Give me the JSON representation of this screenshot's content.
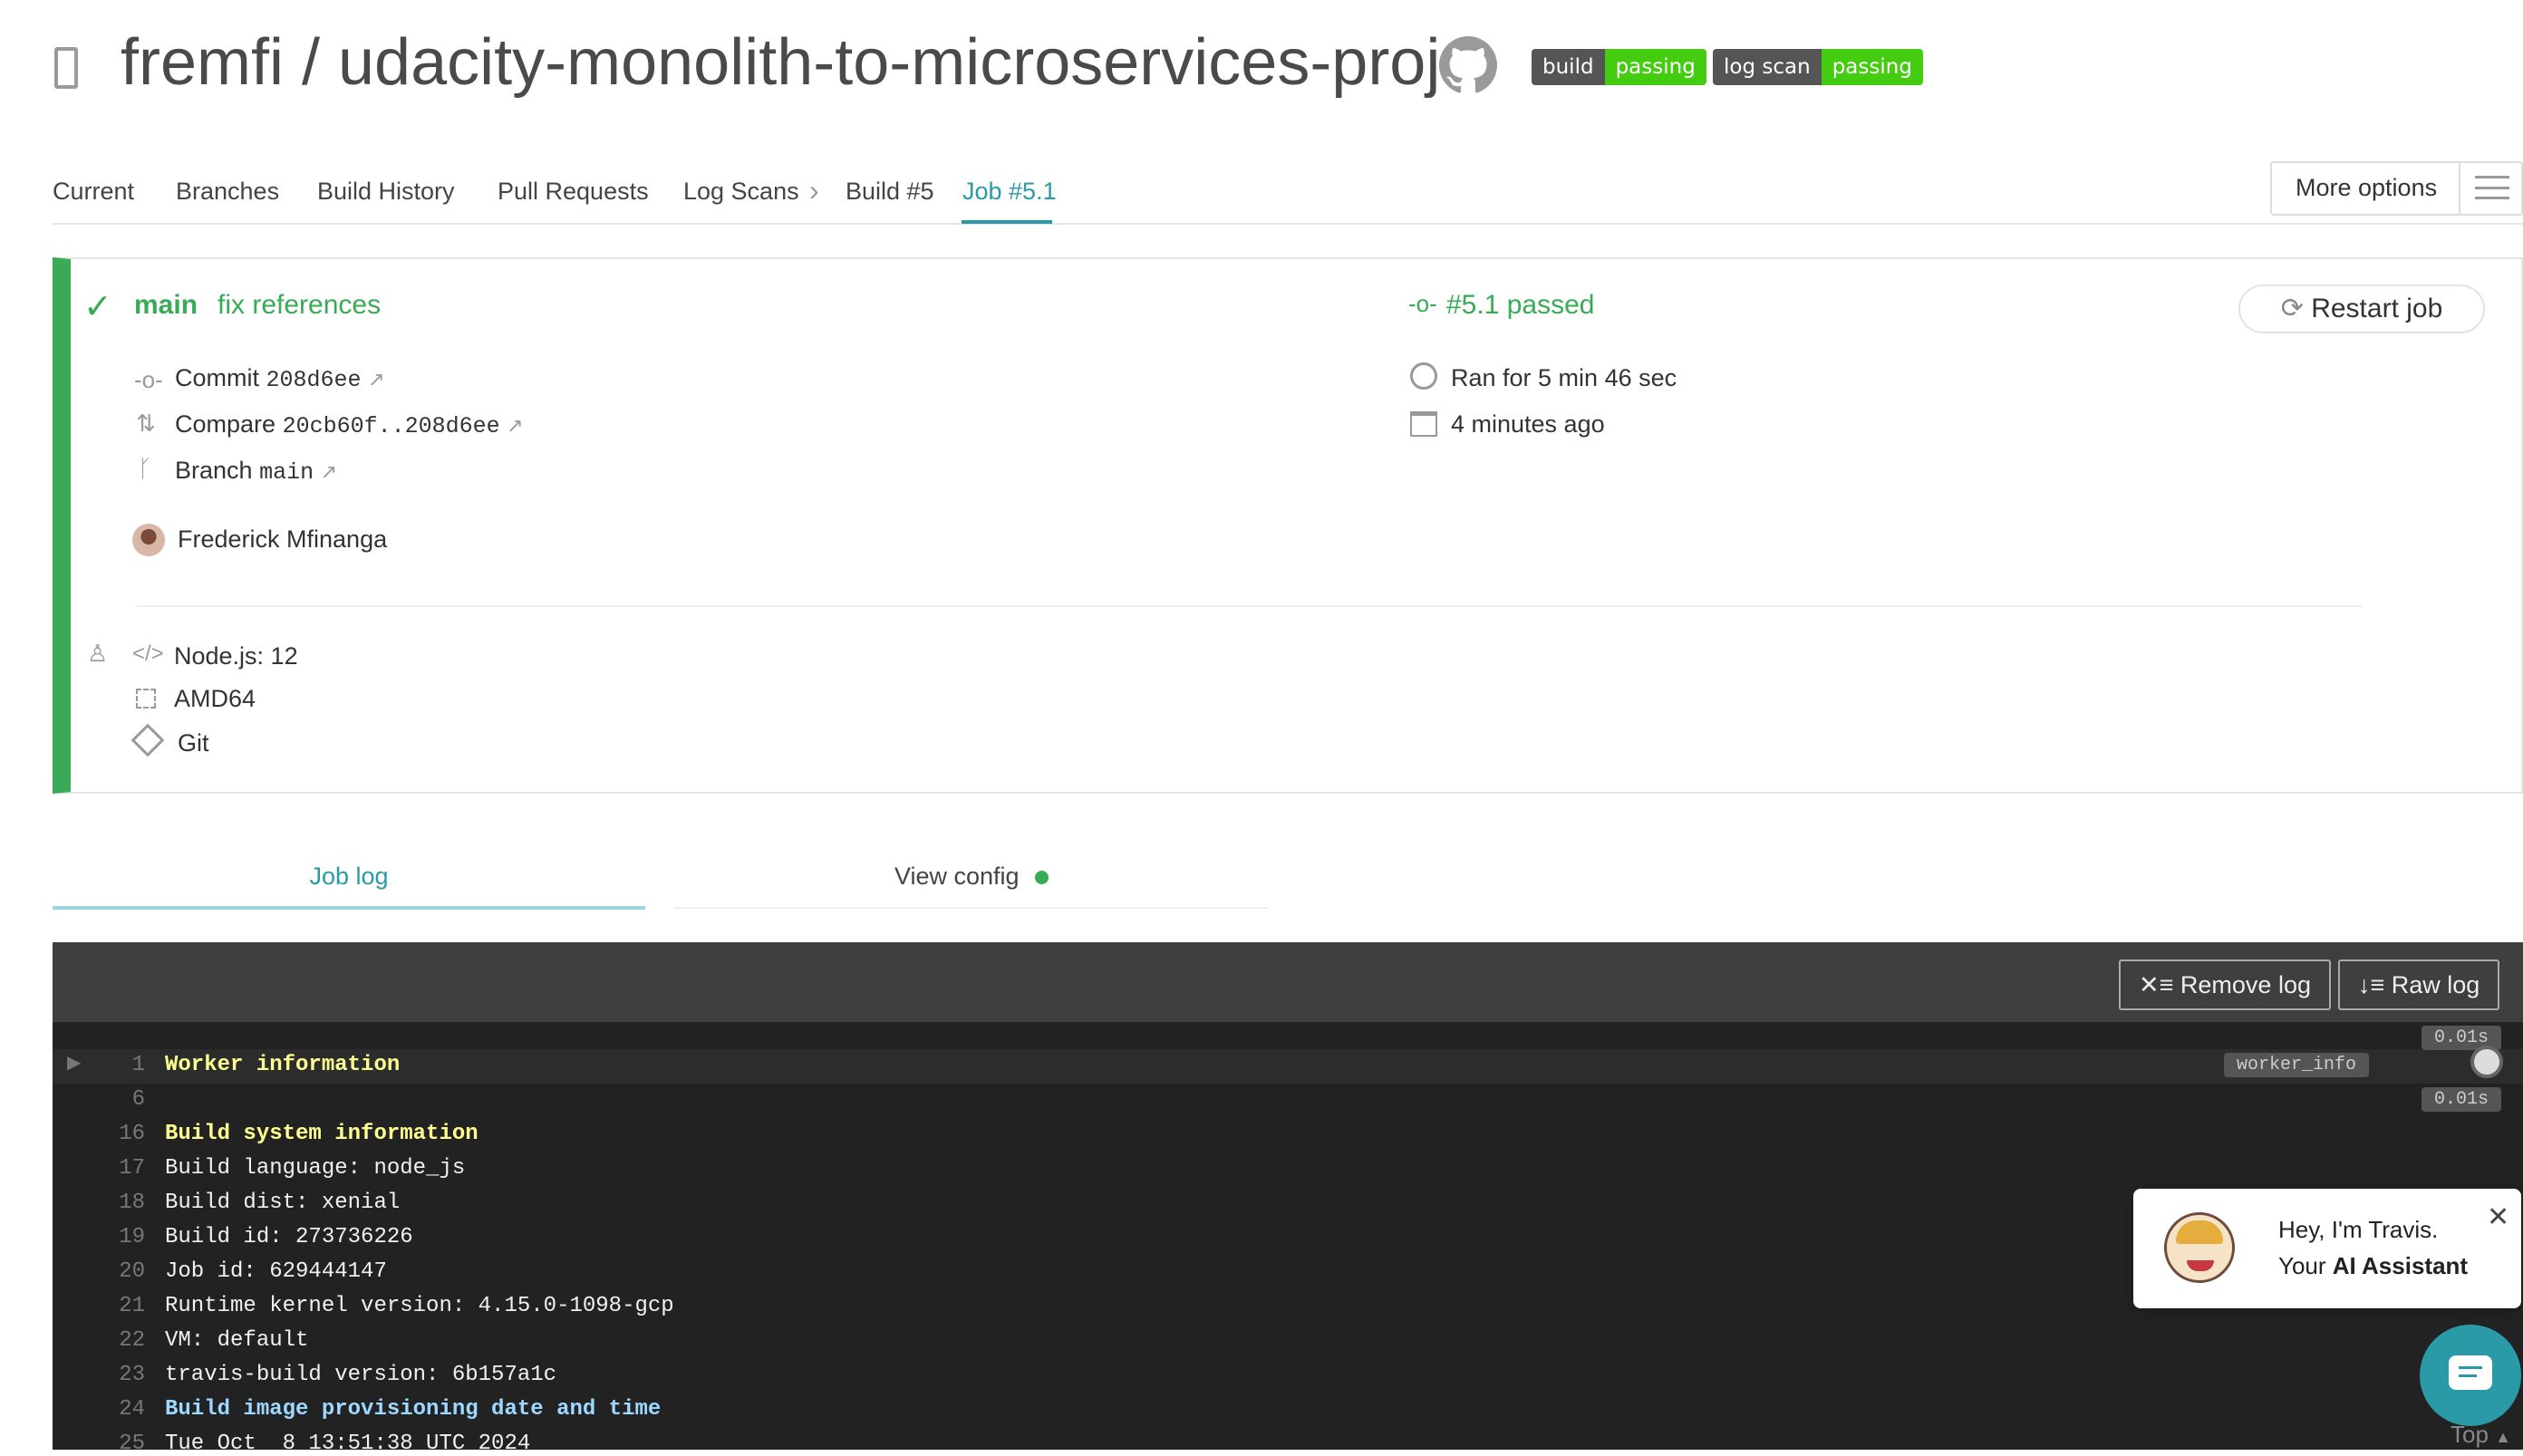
{
  "header": {
    "title": "fremfi / udacity-monolith-to-microservices-proj",
    "badges": [
      {
        "left": "build",
        "right": "passing"
      },
      {
        "left": "log scan",
        "right": "passing"
      }
    ]
  },
  "nav": {
    "items": [
      "Current",
      "Branches",
      "Build History",
      "Pull Requests",
      "Log Scans"
    ],
    "build": "Build #5",
    "job": "Job #5.1",
    "more_options": "More options"
  },
  "job": {
    "branch": "main",
    "message": "fix references",
    "status": "#5.1 passed",
    "restart": "Restart job",
    "commit_label": "Commit",
    "commit": "208d6ee",
    "compare_label": "Compare",
    "compare": "20cb60f..208d6ee",
    "branch_label": "Branch",
    "branch_value": "main",
    "ran_for": "Ran for 5 min 46 sec",
    "time_ago": "4 minutes ago",
    "author": "Frederick Mfinanga",
    "language": "Node.js: 12",
    "arch": "AMD64",
    "vcs": "Git"
  },
  "tabs": {
    "job_log": "Job log",
    "view_config": "View config"
  },
  "log": {
    "remove_log": "Remove log",
    "raw_log": "Raw log",
    "lines": [
      {
        "n": "1",
        "t": "Worker information",
        "style": "y"
      },
      {
        "n": "6",
        "t": "",
        "style": ""
      },
      {
        "n": "16",
        "t": "Build system information",
        "style": "y"
      },
      {
        "n": "17",
        "t": "Build language: node_js",
        "style": ""
      },
      {
        "n": "18",
        "t": "Build dist: xenial",
        "style": ""
      },
      {
        "n": "19",
        "t": "Build id: 273736226",
        "style": ""
      },
      {
        "n": "20",
        "t": "Job id: 629444147",
        "style": ""
      },
      {
        "n": "21",
        "t": "Runtime kernel version: 4.15.0-1098-gcp",
        "style": ""
      },
      {
        "n": "22",
        "t": "VM: default",
        "style": ""
      },
      {
        "n": "23",
        "t": "travis-build version: 6b157a1c",
        "style": ""
      },
      {
        "n": "24",
        "t": "Build image provisioning date and time",
        "style": "b"
      },
      {
        "n": "25",
        "t": "Tue Oct  8 13:51:38 UTC 2024",
        "style": ""
      }
    ],
    "worker_tag": "worker_info",
    "timing1": "0.01s",
    "timing2": "0.01s"
  },
  "assistant": {
    "greeting": "Hey, I'm Travis.",
    "subtitle_prefix": "Your ",
    "subtitle_bold": "AI Assistant"
  },
  "top_label": "Top"
}
